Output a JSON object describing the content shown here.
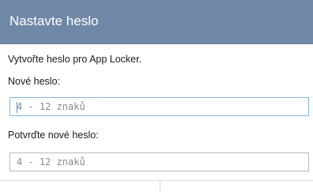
{
  "dialog": {
    "title": "Nastavte heslo",
    "intro": "Vytvořte heslo pro App Locker.",
    "new_password_label": "Nové heslo:",
    "new_password_placeholder": "4 - 12 znaků",
    "new_password_value": "",
    "confirm_password_label": "Potvrďte nové heslo:",
    "confirm_password_placeholder": "4 - 12 znaků",
    "confirm_password_value": ""
  },
  "colors": {
    "title_bar": "#6f88a6",
    "focused_field_border": "#7fb6d9"
  }
}
